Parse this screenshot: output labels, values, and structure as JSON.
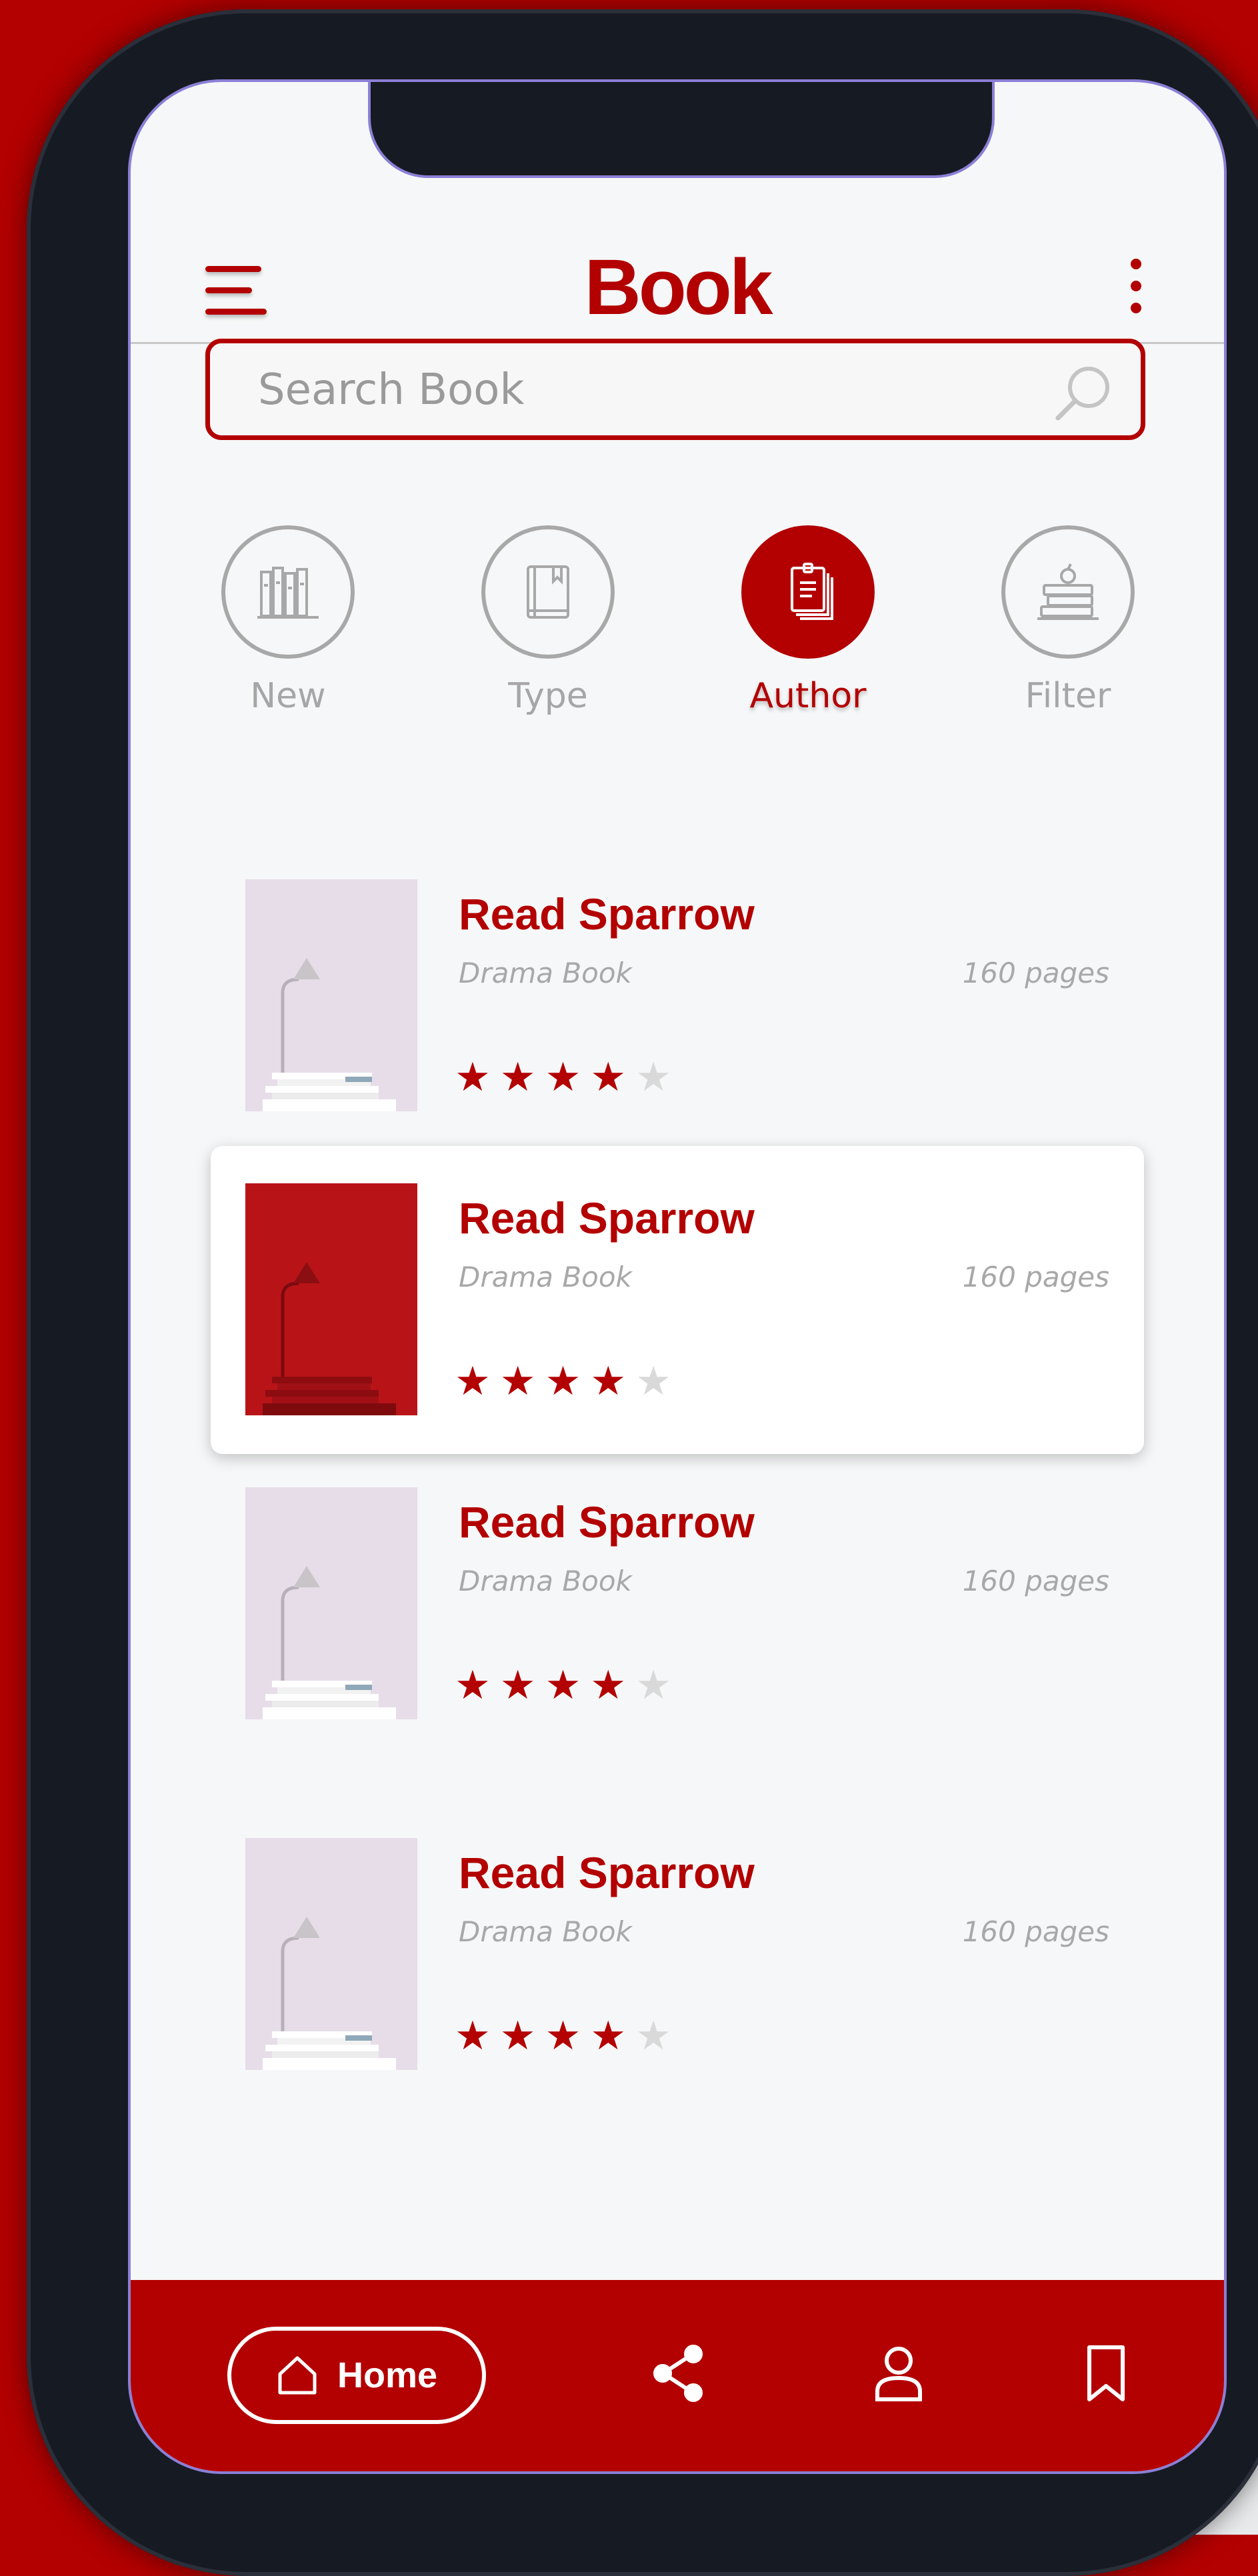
{
  "app": {
    "logo_text": "Book"
  },
  "search": {
    "placeholder": "Search Book"
  },
  "categories": [
    {
      "label": "New",
      "icon": "bookshelf-icon",
      "active": false
    },
    {
      "label": "Type",
      "icon": "book-icon",
      "active": false
    },
    {
      "label": "Author",
      "icon": "document-stack-icon",
      "active": true
    },
    {
      "label": "Filter",
      "icon": "books-apple-icon",
      "active": false
    }
  ],
  "books": [
    {
      "title": "Read Sparrow",
      "genre": "Drama Book",
      "pages": "160 pages",
      "rating": 4,
      "max": 5,
      "selected": false
    },
    {
      "title": "Read Sparrow",
      "genre": "Drama Book",
      "pages": "160 pages",
      "rating": 4,
      "max": 5,
      "selected": true
    },
    {
      "title": "Read Sparrow",
      "genre": "Drama Book",
      "pages": "160 pages",
      "rating": 4,
      "max": 5,
      "selected": false
    },
    {
      "title": "Read Sparrow",
      "genre": "Drama Book",
      "pages": "160 pages",
      "rating": 4,
      "max": 5,
      "selected": false
    }
  ],
  "bottom_nav": {
    "home_label": "Home",
    "items": [
      "home-icon",
      "share-icon",
      "user-icon",
      "bookmark-icon"
    ]
  },
  "colors": {
    "accent": "#b30000",
    "muted": "#a8a8a8",
    "background": "#f6f7f8"
  }
}
